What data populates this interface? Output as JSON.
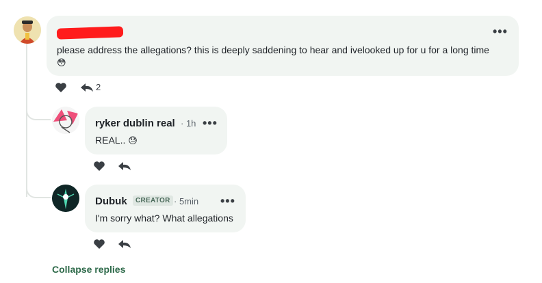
{
  "colors": {
    "accent": "#2e6a4a",
    "bubble": "#f1f5f2",
    "redaction": "#ff1c1c"
  },
  "top_comment": {
    "author_redacted": true,
    "text": "please address the allegations? this is deeply saddening to hear and ivelooked up for u for a long time",
    "emoji": "😳",
    "reply_count": "2",
    "more_icon": "more-horizontal-icon"
  },
  "replies": [
    {
      "author": "ryker dublin real",
      "time": "· 1h",
      "text": "REAL..",
      "emoji": "😓"
    },
    {
      "author": "Dubuk",
      "badge": "CREATOR",
      "time": "· 5min",
      "text": "I'm sorry what? What allegations"
    }
  ],
  "collapse_label": "Collapse replies"
}
